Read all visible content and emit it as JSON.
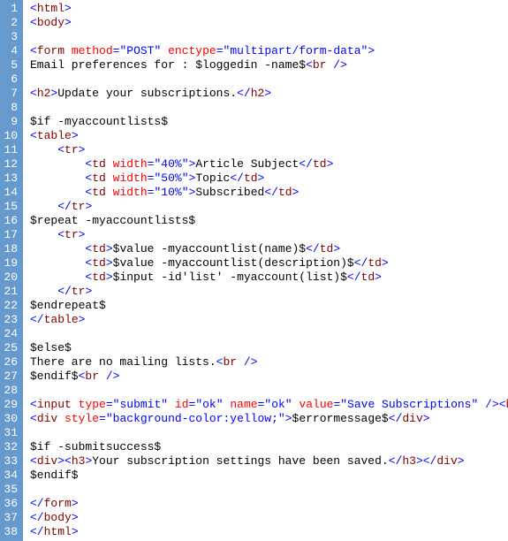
{
  "lines": [
    {
      "n": "1",
      "seg": [
        [
          "p",
          "<"
        ],
        [
          "tg",
          "html"
        ],
        [
          "p",
          ">"
        ]
      ]
    },
    {
      "n": "2",
      "seg": [
        [
          "p",
          "<"
        ],
        [
          "tg",
          "body"
        ],
        [
          "p",
          ">"
        ]
      ]
    },
    {
      "n": "3",
      "seg": []
    },
    {
      "n": "4",
      "seg": [
        [
          "p",
          "<"
        ],
        [
          "tg",
          "form"
        ],
        [
          "tx",
          " "
        ],
        [
          "an",
          "method"
        ],
        [
          "p",
          "="
        ],
        [
          "av",
          "\"POST\""
        ],
        [
          "tx",
          " "
        ],
        [
          "an",
          "enctype"
        ],
        [
          "p",
          "="
        ],
        [
          "av",
          "\"multipart/form-data\""
        ],
        [
          "p",
          ">"
        ]
      ]
    },
    {
      "n": "5",
      "seg": [
        [
          "tx",
          "Email preferences for : $loggedin -name$"
        ],
        [
          "p",
          "<"
        ],
        [
          "tg",
          "br"
        ],
        [
          "tx",
          " "
        ],
        [
          "p",
          "/>"
        ]
      ]
    },
    {
      "n": "6",
      "seg": []
    },
    {
      "n": "7",
      "seg": [
        [
          "p",
          "<"
        ],
        [
          "tg",
          "h2"
        ],
        [
          "p",
          ">"
        ],
        [
          "tx",
          "Update your subscriptions."
        ],
        [
          "p",
          "</"
        ],
        [
          "tg",
          "h2"
        ],
        [
          "p",
          ">"
        ]
      ]
    },
    {
      "n": "8",
      "seg": []
    },
    {
      "n": "9",
      "seg": [
        [
          "tx",
          "$if -myaccountlists$"
        ]
      ]
    },
    {
      "n": "10",
      "seg": [
        [
          "p",
          "<"
        ],
        [
          "tg",
          "table"
        ],
        [
          "p",
          ">"
        ]
      ]
    },
    {
      "n": "11",
      "seg": [
        [
          "tx",
          "    "
        ],
        [
          "p",
          "<"
        ],
        [
          "tg",
          "tr"
        ],
        [
          "p",
          ">"
        ]
      ]
    },
    {
      "n": "12",
      "seg": [
        [
          "tx",
          "        "
        ],
        [
          "p",
          "<"
        ],
        [
          "tg",
          "td"
        ],
        [
          "tx",
          " "
        ],
        [
          "an",
          "width"
        ],
        [
          "p",
          "="
        ],
        [
          "av",
          "\"40%\""
        ],
        [
          "p",
          ">"
        ],
        [
          "tx",
          "Article Subject"
        ],
        [
          "p",
          "</"
        ],
        [
          "tg",
          "td"
        ],
        [
          "p",
          ">"
        ]
      ]
    },
    {
      "n": "13",
      "seg": [
        [
          "tx",
          "        "
        ],
        [
          "p",
          "<"
        ],
        [
          "tg",
          "td"
        ],
        [
          "tx",
          " "
        ],
        [
          "an",
          "width"
        ],
        [
          "p",
          "="
        ],
        [
          "av",
          "\"50%\""
        ],
        [
          "p",
          ">"
        ],
        [
          "tx",
          "Topic"
        ],
        [
          "p",
          "</"
        ],
        [
          "tg",
          "td"
        ],
        [
          "p",
          ">"
        ]
      ]
    },
    {
      "n": "14",
      "seg": [
        [
          "tx",
          "        "
        ],
        [
          "p",
          "<"
        ],
        [
          "tg",
          "td"
        ],
        [
          "tx",
          " "
        ],
        [
          "an",
          "width"
        ],
        [
          "p",
          "="
        ],
        [
          "av",
          "\"10%\""
        ],
        [
          "p",
          ">"
        ],
        [
          "tx",
          "Subscribed"
        ],
        [
          "p",
          "</"
        ],
        [
          "tg",
          "td"
        ],
        [
          "p",
          ">"
        ]
      ]
    },
    {
      "n": "15",
      "seg": [
        [
          "tx",
          "    "
        ],
        [
          "p",
          "</"
        ],
        [
          "tg",
          "tr"
        ],
        [
          "p",
          ">"
        ]
      ]
    },
    {
      "n": "16",
      "seg": [
        [
          "tx",
          "$repeat -myaccountlists$"
        ]
      ]
    },
    {
      "n": "17",
      "seg": [
        [
          "tx",
          "    "
        ],
        [
          "p",
          "<"
        ],
        [
          "tg",
          "tr"
        ],
        [
          "p",
          ">"
        ]
      ]
    },
    {
      "n": "18",
      "seg": [
        [
          "tx",
          "        "
        ],
        [
          "p",
          "<"
        ],
        [
          "tg",
          "td"
        ],
        [
          "p",
          ">"
        ],
        [
          "tx",
          "$value -myaccountlist(name)$"
        ],
        [
          "p",
          "</"
        ],
        [
          "tg",
          "td"
        ],
        [
          "p",
          ">"
        ]
      ]
    },
    {
      "n": "19",
      "seg": [
        [
          "tx",
          "        "
        ],
        [
          "p",
          "<"
        ],
        [
          "tg",
          "td"
        ],
        [
          "p",
          ">"
        ],
        [
          "tx",
          "$value -myaccountlist(description)$"
        ],
        [
          "p",
          "</"
        ],
        [
          "tg",
          "td"
        ],
        [
          "p",
          ">"
        ]
      ]
    },
    {
      "n": "20",
      "seg": [
        [
          "tx",
          "        "
        ],
        [
          "p",
          "<"
        ],
        [
          "tg",
          "td"
        ],
        [
          "p",
          ">"
        ],
        [
          "tx",
          "$input -id'list' -myaccount(list)$"
        ],
        [
          "p",
          "</"
        ],
        [
          "tg",
          "td"
        ],
        [
          "p",
          ">"
        ]
      ]
    },
    {
      "n": "21",
      "seg": [
        [
          "tx",
          "    "
        ],
        [
          "p",
          "</"
        ],
        [
          "tg",
          "tr"
        ],
        [
          "p",
          ">"
        ]
      ]
    },
    {
      "n": "22",
      "seg": [
        [
          "tx",
          "$endrepeat$"
        ]
      ]
    },
    {
      "n": "23",
      "seg": [
        [
          "p",
          "</"
        ],
        [
          "tg",
          "table"
        ],
        [
          "p",
          ">"
        ]
      ]
    },
    {
      "n": "24",
      "seg": []
    },
    {
      "n": "25",
      "seg": [
        [
          "tx",
          "$else$"
        ]
      ]
    },
    {
      "n": "26",
      "seg": [
        [
          "tx",
          "There are no mailing lists."
        ],
        [
          "p",
          "<"
        ],
        [
          "tg",
          "br"
        ],
        [
          "tx",
          " "
        ],
        [
          "p",
          "/>"
        ]
      ]
    },
    {
      "n": "27",
      "seg": [
        [
          "tx",
          "$endif$"
        ],
        [
          "p",
          "<"
        ],
        [
          "tg",
          "br"
        ],
        [
          "tx",
          " "
        ],
        [
          "p",
          "/>"
        ]
      ]
    },
    {
      "n": "28",
      "seg": []
    },
    {
      "n": "29",
      "seg": [
        [
          "p",
          "<"
        ],
        [
          "tg",
          "input"
        ],
        [
          "tx",
          " "
        ],
        [
          "an",
          "type"
        ],
        [
          "p",
          "="
        ],
        [
          "av",
          "\"submit\""
        ],
        [
          "tx",
          " "
        ],
        [
          "an",
          "id"
        ],
        [
          "p",
          "="
        ],
        [
          "av",
          "\"ok\""
        ],
        [
          "tx",
          " "
        ],
        [
          "an",
          "name"
        ],
        [
          "p",
          "="
        ],
        [
          "av",
          "\"ok\""
        ],
        [
          "tx",
          " "
        ],
        [
          "an",
          "value"
        ],
        [
          "p",
          "="
        ],
        [
          "av",
          "\"Save Subscriptions\""
        ],
        [
          "tx",
          " "
        ],
        [
          "p",
          "/><"
        ],
        [
          "tg",
          "br"
        ],
        [
          "tx",
          " "
        ],
        [
          "p",
          "/>"
        ]
      ]
    },
    {
      "n": "30",
      "seg": [
        [
          "p",
          "<"
        ],
        [
          "tg",
          "div"
        ],
        [
          "tx",
          " "
        ],
        [
          "an",
          "style"
        ],
        [
          "p",
          "="
        ],
        [
          "av",
          "\"background-color:yellow;\""
        ],
        [
          "p",
          ">"
        ],
        [
          "tx",
          "$errormessage$"
        ],
        [
          "p",
          "</"
        ],
        [
          "tg",
          "div"
        ],
        [
          "p",
          ">"
        ]
      ]
    },
    {
      "n": "31",
      "seg": []
    },
    {
      "n": "32",
      "seg": [
        [
          "tx",
          "$if -submitsuccess$"
        ]
      ]
    },
    {
      "n": "33",
      "seg": [
        [
          "p",
          "<"
        ],
        [
          "tg",
          "div"
        ],
        [
          "p",
          "><"
        ],
        [
          "tg",
          "h3"
        ],
        [
          "p",
          ">"
        ],
        [
          "tx",
          "Your subscription settings have been saved."
        ],
        [
          "p",
          "</"
        ],
        [
          "tg",
          "h3"
        ],
        [
          "p",
          "></"
        ],
        [
          "tg",
          "div"
        ],
        [
          "p",
          ">"
        ]
      ]
    },
    {
      "n": "34",
      "seg": [
        [
          "tx",
          "$endif$"
        ]
      ]
    },
    {
      "n": "35",
      "seg": []
    },
    {
      "n": "36",
      "seg": [
        [
          "p",
          "</"
        ],
        [
          "tg",
          "form"
        ],
        [
          "p",
          ">"
        ]
      ]
    },
    {
      "n": "37",
      "seg": [
        [
          "p",
          "</"
        ],
        [
          "tg",
          "body"
        ],
        [
          "p",
          ">"
        ]
      ]
    },
    {
      "n": "38",
      "seg": [
        [
          "p",
          "</"
        ],
        [
          "tg",
          "html"
        ],
        [
          "p",
          ">"
        ]
      ]
    }
  ]
}
